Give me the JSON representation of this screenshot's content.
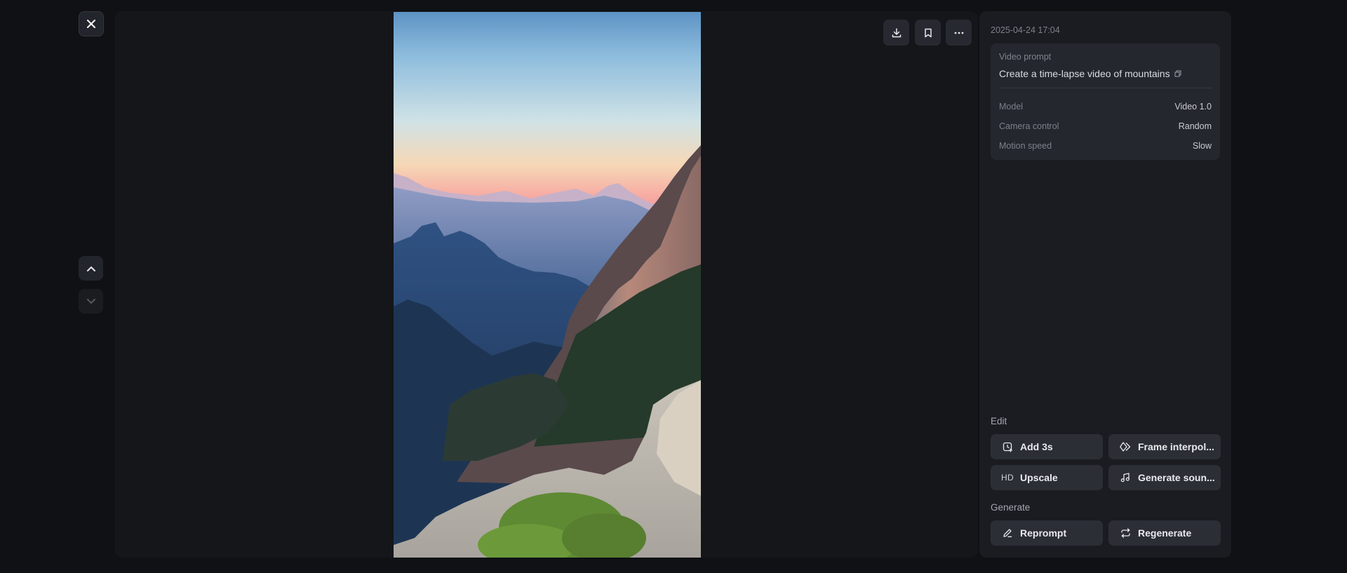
{
  "navigation": {
    "close_icon": "close-icon",
    "up_icon": "chevron-up-icon",
    "down_icon": "chevron-down-icon"
  },
  "toolbar": {
    "download_icon": "download-icon",
    "bookmark_icon": "bookmark-icon",
    "more_icon": "more-horizontal-icon"
  },
  "details": {
    "timestamp": "2025-04-24 17:04",
    "prompt_label": "Video prompt",
    "prompt_text": "Create a time-lapse video of mountains",
    "meta": [
      {
        "key": "Model",
        "value": "Video 1.0"
      },
      {
        "key": "Camera control",
        "value": "Random"
      },
      {
        "key": "Motion speed",
        "value": "Slow"
      }
    ]
  },
  "edit": {
    "label": "Edit",
    "buttons": [
      {
        "label": "Add 3s",
        "icon": "clock-plus-icon"
      },
      {
        "label": "Frame interpol...",
        "icon": "diamond-frames-icon"
      },
      {
        "label": "Upscale",
        "icon": "hd-icon",
        "icon_text": "HD"
      },
      {
        "label": "Generate soun...",
        "icon": "music-note-icon"
      }
    ]
  },
  "generate": {
    "label": "Generate",
    "buttons": [
      {
        "label": "Reprompt",
        "icon": "pencil-icon"
      },
      {
        "label": "Regenerate",
        "icon": "repeat-icon"
      }
    ]
  },
  "colors": {
    "background": "#0f1114",
    "panel": "#1a1c21",
    "card": "#24272d",
    "button": "#2b2e35"
  }
}
